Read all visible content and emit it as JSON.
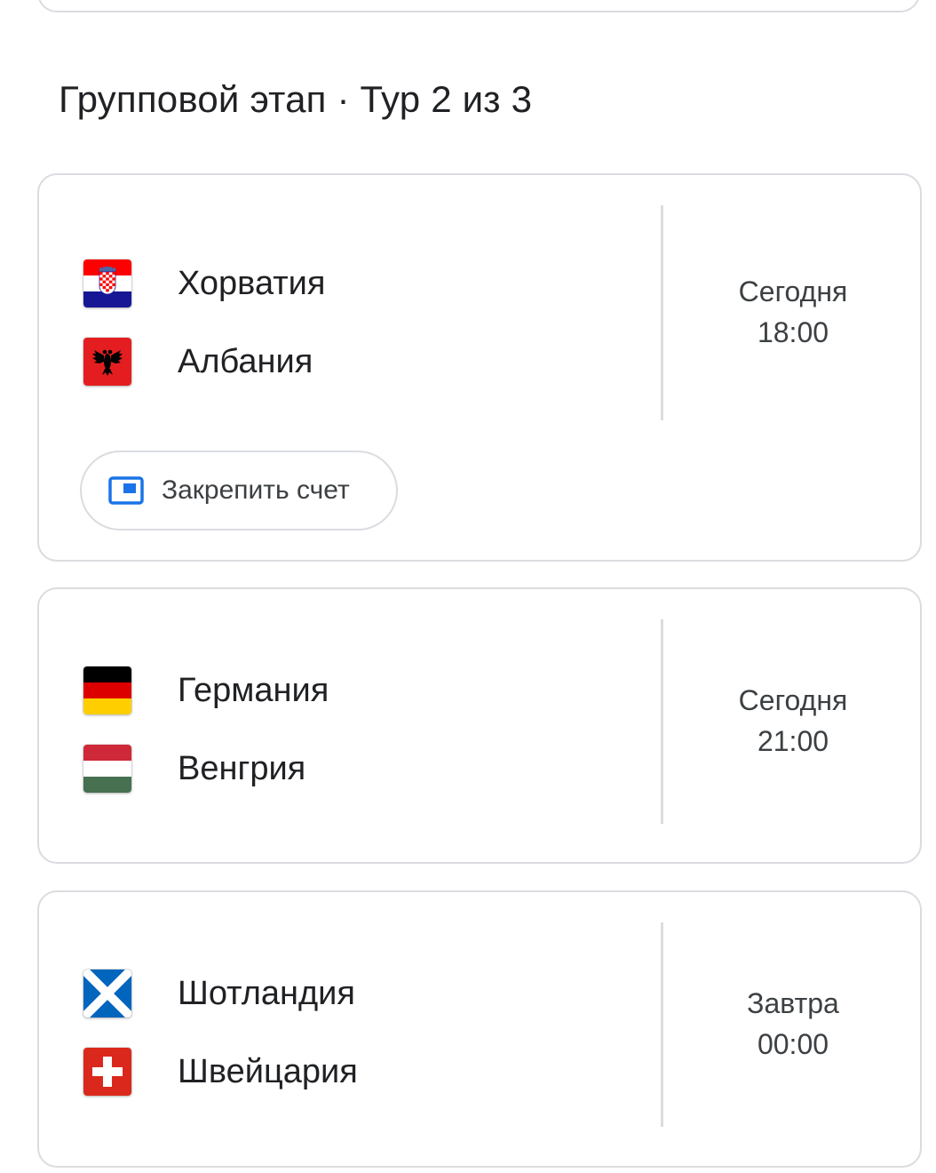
{
  "section": {
    "title": "Групповой этап · Тур 2 из 3"
  },
  "matches": [
    {
      "team1": {
        "name": "Хорватия",
        "flag": "croatia-flag"
      },
      "team2": {
        "name": "Албания",
        "flag": "albania-flag"
      },
      "day": "Сегодня",
      "time": "18:00",
      "pin_label": "Закрепить счет"
    },
    {
      "team1": {
        "name": "Германия",
        "flag": "germany-flag"
      },
      "team2": {
        "name": "Венгрия",
        "flag": "hungary-flag"
      },
      "day": "Сегодня",
      "time": "21:00"
    },
    {
      "team1": {
        "name": "Шотландия",
        "flag": "scotland-flag"
      },
      "team2": {
        "name": "Швейцария",
        "flag": "switzerland-flag"
      },
      "day": "Завтра",
      "time": "00:00"
    }
  ],
  "colors": {
    "accent": "#1a73e8",
    "border": "#dadce0",
    "text": "#202124",
    "secondary_text": "#3c4043"
  }
}
